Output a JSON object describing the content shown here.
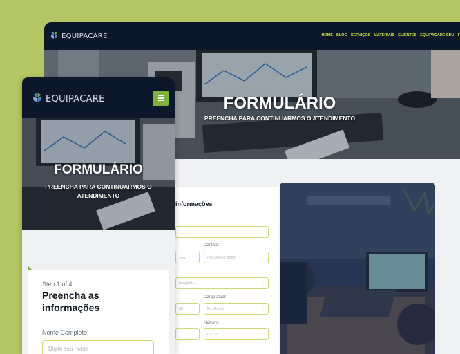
{
  "brand": {
    "name": "EQUIPACARE"
  },
  "colors": {
    "background": "#b5c764",
    "nav": "#0c1829",
    "accent": "#c8e04a",
    "button": "#7fb23a"
  },
  "desktop": {
    "nav": [
      "HOME",
      "BLOG",
      "SERVIÇOS",
      "MATERIAIS",
      "CLIENTES",
      "EQUIPACARE EDU",
      "F"
    ],
    "hero_title": "FORMULÁRIO",
    "hero_subtitle": "PREENCHA PARA CONTINUARMOS O ATENDIMENTO",
    "card_title": "informações",
    "fields": {
      "contato_label": "Contato:",
      "contato_placeholder": "(00) 00000-0000",
      "input2_placeholder": "ven",
      "hospital_placeholder": "hospital...",
      "cargo_label": "Cargo atual:",
      "cargo_placeholder": "Ex: Diretor",
      "input4_placeholder": "00",
      "numero_label": "Número:",
      "numero_placeholder": "Ex: 10"
    }
  },
  "mobile": {
    "hero_title": "FORMULÁRIO",
    "hero_subtitle": "PREENCHA PARA CONTINUARMOS O ATENDIMENTO",
    "step": "Step 1 of 4",
    "form_title": "Preencha as informações",
    "name_label": "Nome Completo:",
    "name_placeholder": "Digite seu nome"
  }
}
